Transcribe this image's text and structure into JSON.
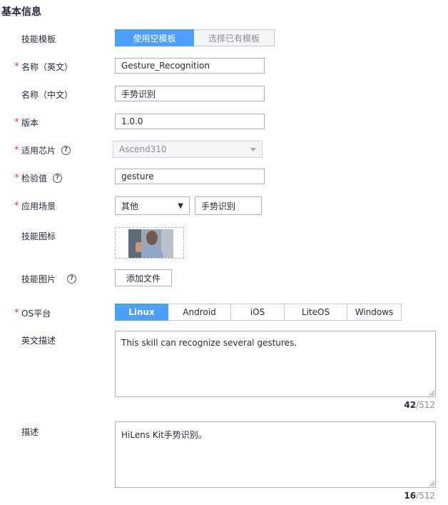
{
  "section": {
    "title": "基本信息"
  },
  "template": {
    "label": "技能模板",
    "options": [
      "使用空模板",
      "选择已有模板"
    ]
  },
  "name_en": {
    "label": "名称（英文）",
    "value": "Gesture_Recognition"
  },
  "name_cn": {
    "label": "名称（中文）",
    "value": "手势识别"
  },
  "version": {
    "label": "版本",
    "value": "1.0.0"
  },
  "chip": {
    "label": "适用芯片",
    "value": "Ascend310"
  },
  "checksum": {
    "label": "检验值",
    "value": "gesture"
  },
  "scenario": {
    "label": "应用场景",
    "select_value": "其他",
    "input_value": "手势识别"
  },
  "skill_icon": {
    "label": "技能图标"
  },
  "skill_image": {
    "label": "技能图片",
    "button": "添加文件"
  },
  "os": {
    "label": "OS平台",
    "options": [
      "Linux",
      "Android",
      "iOS",
      "LiteOS",
      "Windows"
    ],
    "selected": "Linux"
  },
  "desc_en": {
    "label": "英文描述",
    "value": "This skill can recognize several gestures.",
    "count": "42",
    "max": "/512"
  },
  "desc": {
    "label": "描述",
    "value": "HiLens Kit手势识别。",
    "count": "16",
    "max": "/512"
  },
  "required_mark": "*",
  "help_glyph": "?",
  "colors": {
    "accent": "#4b9fff",
    "required": "#e4393c"
  }
}
